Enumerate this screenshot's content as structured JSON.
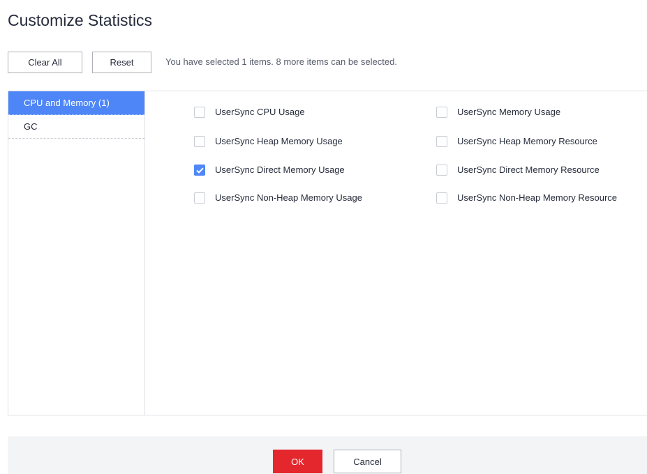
{
  "dialog": {
    "title": "Customize Statistics"
  },
  "toolbar": {
    "clear_all_label": "Clear All",
    "reset_label": "Reset",
    "selection_hint": "You have selected 1 items. 8 more items can be selected."
  },
  "sidebar": {
    "items": [
      {
        "label": "CPU and Memory (1)",
        "active": true
      },
      {
        "label": "GC",
        "active": false
      }
    ]
  },
  "options": [
    {
      "label": "UserSync CPU Usage",
      "checked": false
    },
    {
      "label": "UserSync Memory Usage",
      "checked": false
    },
    {
      "label": "UserSync Heap Memory Usage",
      "checked": false
    },
    {
      "label": "UserSync Heap Memory Resource",
      "checked": false
    },
    {
      "label": "UserSync Direct Memory Usage",
      "checked": true
    },
    {
      "label": "UserSync Direct Memory Resource",
      "checked": false
    },
    {
      "label": "UserSync Non-Heap Memory Usage",
      "checked": false
    },
    {
      "label": "UserSync Non-Heap Memory Resource",
      "checked": false
    }
  ],
  "footer": {
    "ok_label": "OK",
    "cancel_label": "Cancel"
  },
  "colors": {
    "accent": "#4f87f7",
    "primary_button": "#e4262d",
    "footer_background": "#f3f4f6"
  }
}
